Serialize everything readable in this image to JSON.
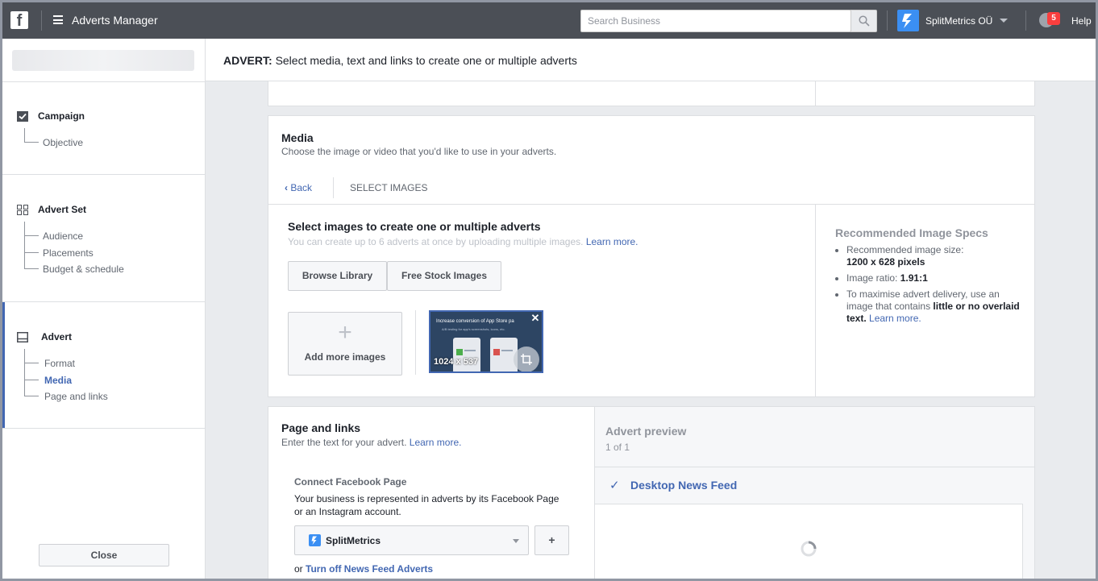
{
  "topbar": {
    "logo": "f",
    "app_title": "Adverts Manager",
    "search_placeholder": "Search Business",
    "business_name": "SplitMetrics OÜ",
    "notif_count": "5",
    "help": "Help"
  },
  "sidebar": {
    "campaign": {
      "title": "Campaign",
      "items": [
        "Objective"
      ]
    },
    "advert_set": {
      "title": "Advert Set",
      "items": [
        "Audience",
        "Placements",
        "Budget & schedule"
      ]
    },
    "advert": {
      "title": "Advert",
      "items": [
        "Format",
        "Media",
        "Page and links"
      ],
      "active": "Media"
    },
    "close": "Close"
  },
  "header": {
    "prefix": "ADVERT:",
    "text": "Select media, text and links to create one or multiple adverts"
  },
  "media": {
    "title": "Media",
    "subtitle": "Choose the image or video that you'd like to use in your adverts.",
    "back": "Back",
    "crumb": "SELECT IMAGES",
    "select_title": "Select images to create one or multiple adverts",
    "select_sub": "You can create up to 6 adverts at once by uploading multiple images.",
    "learn_more": "Learn more.",
    "browse_library": "Browse Library",
    "free_stock": "Free Stock Images",
    "add_more": "Add more images",
    "thumb_caption": "Increase conversion of App Store pa",
    "thumb_sub": "A/B testing for app's screenshots, icons, etc.",
    "thumb_size": "1024 x 537"
  },
  "specs": {
    "title": "Recommended Image Specs",
    "size_label": "Recommended image size:",
    "size_value": "1200 x 628 pixels",
    "ratio_label": "Image ratio:",
    "ratio_value": "1.91:1",
    "delivery_1": "To maximise advert delivery, use an image that contains",
    "delivery_bold": "little or no overlaid text.",
    "delivery_link": "Learn more."
  },
  "page_links": {
    "title": "Page and links",
    "subtitle": "Enter the text for your advert.",
    "learn_more": "Learn more.",
    "connect_title": "Connect Facebook Page",
    "connect_text": "Your business is represented in adverts by its Facebook Page or an Instagram account.",
    "page_name": "SplitMetrics",
    "add_button": "+",
    "or": "or",
    "turn_off": "Turn off News Feed Adverts"
  },
  "preview": {
    "title": "Advert preview",
    "count": "1 of 1",
    "placement": "Desktop News Feed"
  },
  "colors": {
    "topbar": "#4b4f56",
    "link": "#4267b2",
    "background": "#e9ebee"
  }
}
